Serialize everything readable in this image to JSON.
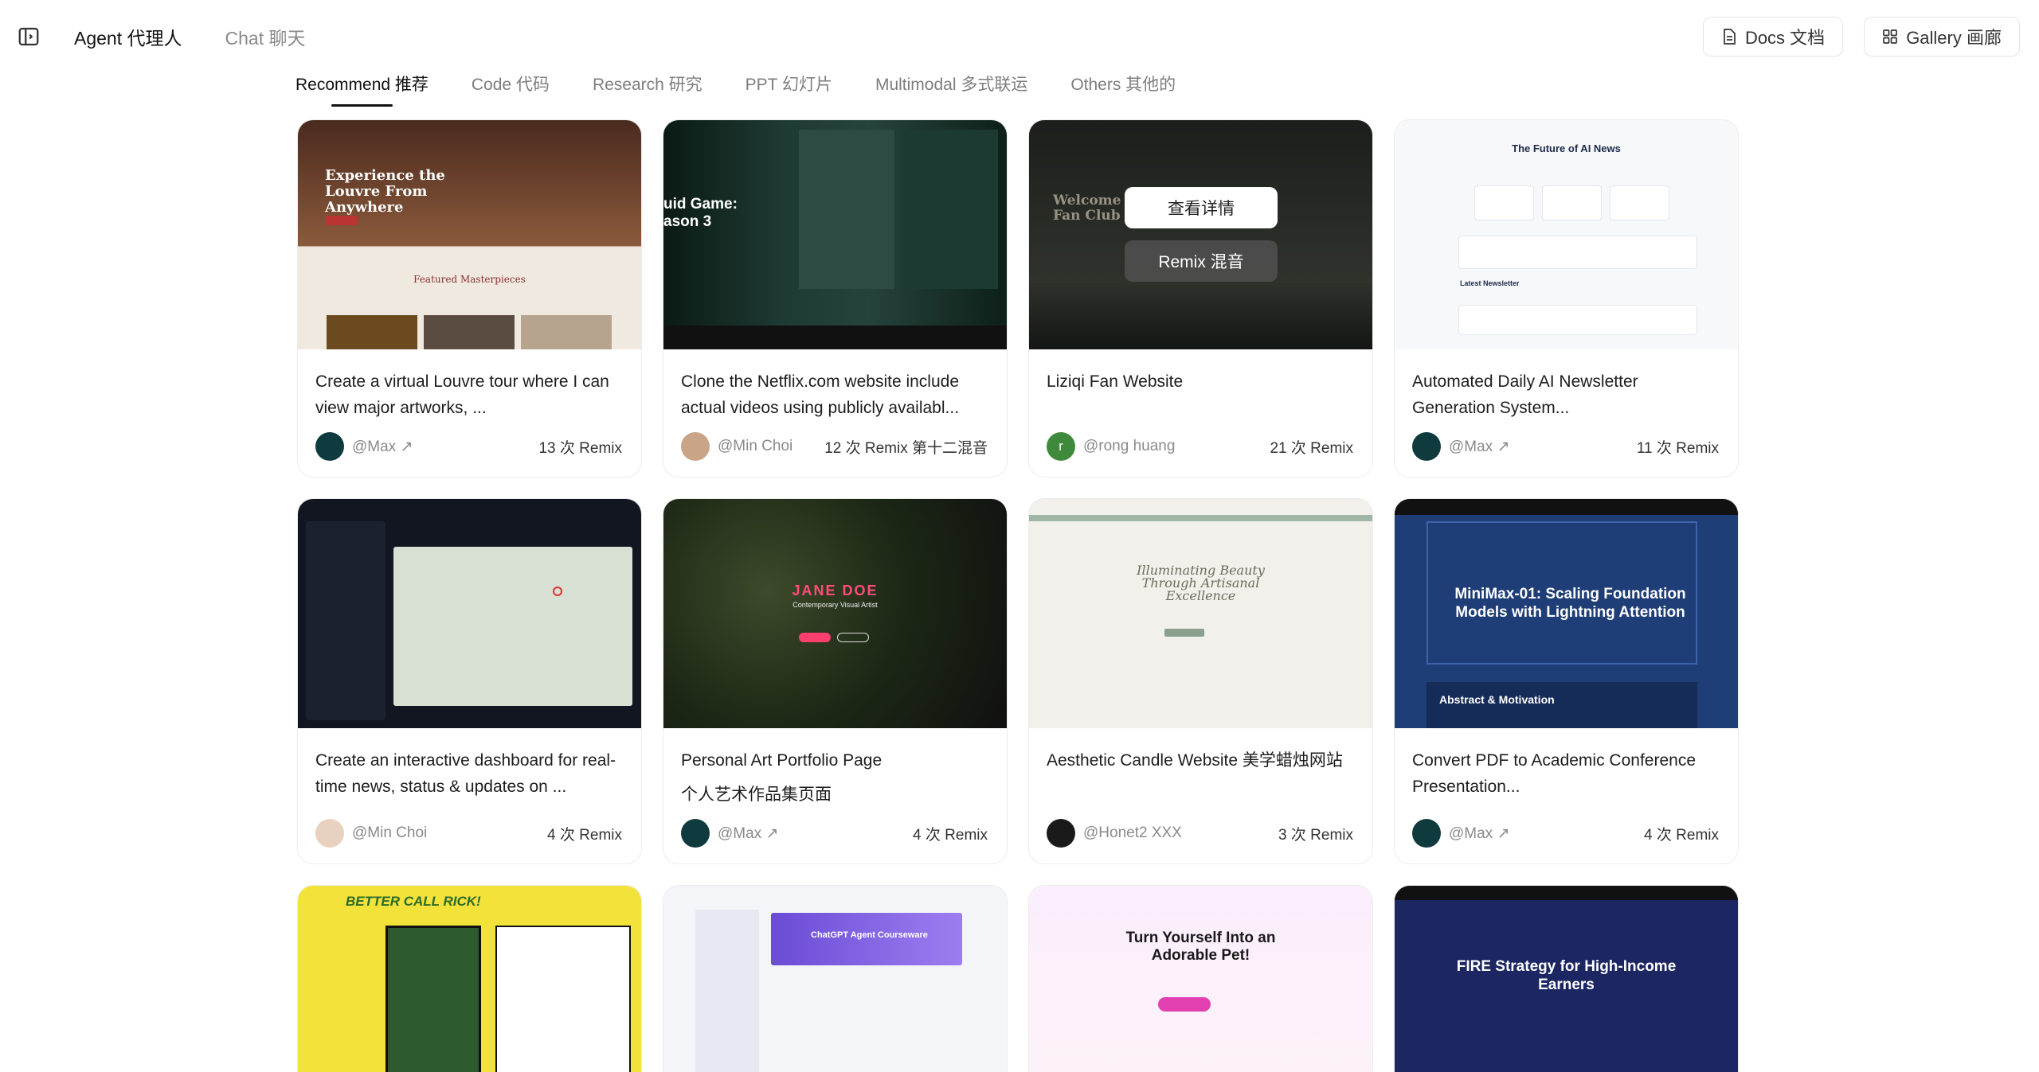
{
  "header": {
    "nav": [
      {
        "label": "Agent  代理人",
        "active": true
      },
      {
        "label": "Chat  聊天",
        "active": false
      }
    ],
    "docs_label": "Docs   文档",
    "gallery_label": "Gallery   画廊"
  },
  "tabs": [
    {
      "label": "Recommend  推荐",
      "active": true
    },
    {
      "label": "Code  代码",
      "active": false
    },
    {
      "label": "Research  研究",
      "active": false
    },
    {
      "label": "PPT  幻灯片",
      "active": false
    },
    {
      "label": "Multimodal  多式联运",
      "active": false
    },
    {
      "label": "Others  其他的",
      "active": false
    }
  ],
  "cards": [
    {
      "title": "Create a virtual Louvre tour where I can view major artworks, ...",
      "author": "@Max ↗",
      "remix": "13 次 Remix",
      "thumb_text": "Experience the Louvre From Anywhere",
      "thumb_sub": "Featured Masterpieces"
    },
    {
      "title": "Clone the Netflix.com website include actual videos using publicly availabl...",
      "author": "@Min Choi",
      "remix": "12 次 Remix   第十二混音",
      "thumb_text": "uid Game: ason 3"
    },
    {
      "title": "Liziqi Fan Website",
      "author": "@rong huang",
      "remix": "21 次 Remix",
      "thumb_text": "Welcome Fan Club",
      "hover_detail": "查看详情",
      "hover_remix": "Remix   混音",
      "avatar_letter": "r"
    },
    {
      "title": "Automated Daily AI Newsletter Generation System...",
      "author": "@Max ↗",
      "remix": "11 次 Remix",
      "thumb_text": "The Future of AI News",
      "thumb_sub": "Latest Newsletter"
    },
    {
      "title": "Create an interactive dashboard for real-time news, status & updates on ...",
      "author": "@Min Choi",
      "remix": "4 次 Remix"
    },
    {
      "title": "Personal Art Portfolio Page",
      "sub": "个人艺术作品集页面",
      "author": "@Max ↗",
      "remix": "4 次 Remix",
      "thumb_text": "JANE DOE",
      "thumb_sub": "Contemporary Visual Artist"
    },
    {
      "title": "Aesthetic Candle Website  美学蜡烛网站",
      "author": "@Honet2 XXX",
      "remix": "3 次 Remix",
      "thumb_text": "Illuminating Beauty Through Artisanal Excellence"
    },
    {
      "title": "Convert PDF to Academic Conference Presentation...",
      "author": "@Max ↗",
      "remix": "4 次 Remix",
      "thumb_text": "MiniMax-01: Scaling Foundation Models with Lightning Attention",
      "thumb_sub": "Abstract & Motivation"
    },
    {
      "title": "",
      "author": "",
      "remix": "",
      "thumb_text": "BETTER CALL RICK!"
    },
    {
      "title": "",
      "author": "",
      "remix": "",
      "thumb_text": "ChatGPT Agent Courseware"
    },
    {
      "title": "",
      "author": "",
      "remix": "",
      "thumb_text": "Turn Yourself Into an Adorable Pet!"
    },
    {
      "title": "",
      "author": "",
      "remix": "",
      "thumb_text": "FIRE Strategy for High-Income Earners"
    }
  ],
  "colors": {
    "accent_dark": "#111111",
    "muted": "#8a8a8a",
    "avatar_green": "#3f8a3a",
    "avatar_teal": "#0f3b3f"
  }
}
